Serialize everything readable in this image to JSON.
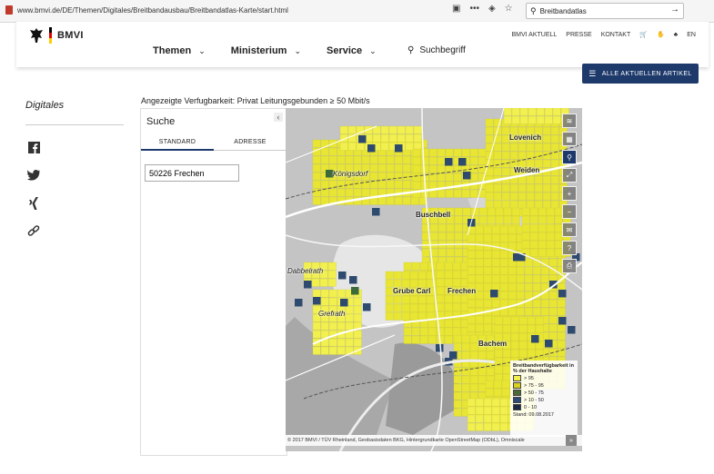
{
  "browser": {
    "url": "www.bmvi.de/DE/Themen/Digitales/Breitbandausbau/Breitbandatlas-Karte/start.html",
    "search_value": "Breitbandatlas",
    "icons": [
      "reader-icon",
      "more-icon",
      "pocket-icon",
      "star-icon"
    ]
  },
  "header": {
    "logo_text": "BMVI",
    "top_links": [
      "BMVI AKTUELL",
      "PRESSE",
      "KONTAKT"
    ],
    "lang": "EN",
    "nav": [
      "Themen",
      "Ministerium",
      "Service"
    ],
    "search_label": "Suchbegriff",
    "alle_artikel": "ALLE AKTUELLEN ARTIKEL"
  },
  "sidebar": {
    "title": "Digitales"
  },
  "availability": "Angezeigte Verfugbarkeit: Privat Leitungsgebunden ≥ 50 Mbit/s",
  "panel": {
    "title": "Suche",
    "tabs": [
      "STANDARD",
      "ADRESSE"
    ],
    "search_value": "50226 Frechen"
  },
  "map": {
    "places": [
      "Lovenich",
      "Weiden",
      "Königsdorf",
      "Buschbell",
      "Dabbelrath",
      "Grube Carl",
      "Frechen",
      "Grefrath",
      "Bachem"
    ],
    "legend": {
      "title": "Breitbandverfügbarkeit in % der Haushalte",
      "rows": [
        "> 95",
        "> 75 - 95",
        "> 50 - 75",
        "> 10 - 50",
        "0 - 10"
      ],
      "colors": [
        "#f2f04e",
        "#d8d21e",
        "#4a6a3a",
        "#2e4a7a",
        "#1c2a44"
      ],
      "stand": "Stand: 09.08.2017"
    },
    "attribution": "© 2017 BMVI / TÜV Rheinland, Geobasisdaten BKG, Hintergrundkarte OpenStreetMap (ODbL), Omniscale"
  }
}
